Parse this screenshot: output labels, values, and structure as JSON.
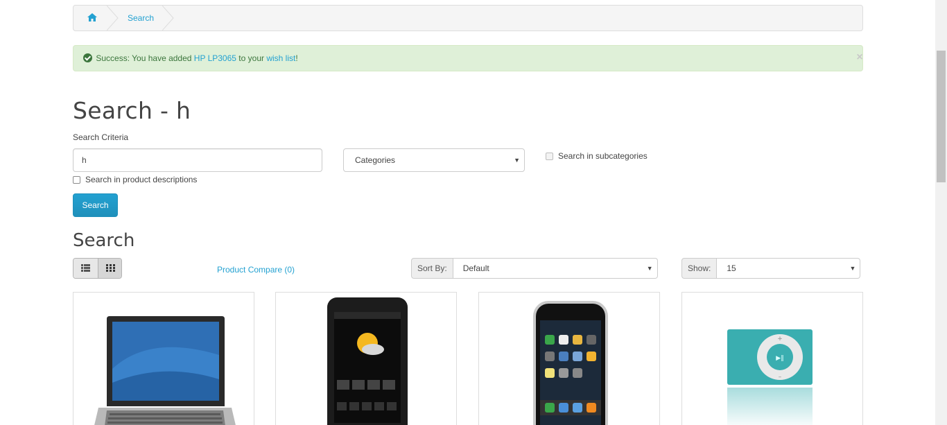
{
  "breadcrumb": {
    "home_icon": "home-icon",
    "current": "Search"
  },
  "alert": {
    "prefix": "Success: You have added ",
    "product_link": "HP LP3065",
    "middle": " to your ",
    "wishlist_link": "wish list",
    "suffix": "!",
    "close": "×"
  },
  "page_title": "Search - h",
  "criteria_label": "Search Criteria",
  "search_input": {
    "value": "h"
  },
  "category_select": {
    "selected": "Categories"
  },
  "subcategories_label": "Search in subcategories",
  "descriptions_label": "Search in product descriptions",
  "search_button": "Search",
  "results_title": "Search",
  "compare_link": "Product Compare (0)",
  "sort": {
    "label": "Sort By:",
    "selected": "Default"
  },
  "show": {
    "label": "Show:",
    "selected": "15"
  },
  "products": [
    {
      "image": "laptop"
    },
    {
      "image": "smartphone"
    },
    {
      "image": "iphone"
    },
    {
      "image": "ipod-shuffle"
    }
  ],
  "colors": {
    "accent": "#23a1d1",
    "success_bg": "#dff0d8",
    "success_text": "#3c763d",
    "button": "#229ac8"
  }
}
